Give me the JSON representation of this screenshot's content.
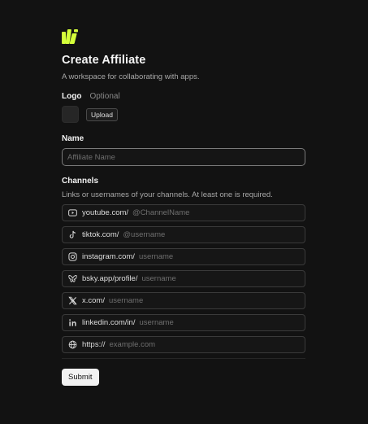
{
  "brand": {
    "accent": "#d4ff3a"
  },
  "header": {
    "title": "Create Affiliate",
    "subtitle": "A workspace for collaborating with apps."
  },
  "logo_field": {
    "label": "Logo",
    "optional": "Optional",
    "upload_label": "Upload"
  },
  "name_field": {
    "label": "Name",
    "placeholder": "Affiliate Name",
    "value": ""
  },
  "channels": {
    "label": "Channels",
    "description": "Links or usernames of your channels. At least one is required.",
    "items": [
      {
        "icon": "youtube-icon",
        "prefix": "youtube.com/",
        "placeholder": "@ChannelName",
        "value": ""
      },
      {
        "icon": "tiktok-icon",
        "prefix": "tiktok.com/",
        "placeholder": "@username",
        "value": ""
      },
      {
        "icon": "instagram-icon",
        "prefix": "instagram.com/",
        "placeholder": "username",
        "value": ""
      },
      {
        "icon": "bluesky-icon",
        "prefix": "bsky.app/profile/",
        "placeholder": "username",
        "value": ""
      },
      {
        "icon": "x-icon",
        "prefix": "x.com/",
        "placeholder": "username",
        "value": ""
      },
      {
        "icon": "linkedin-icon",
        "prefix": "linkedin.com/in/",
        "placeholder": "username",
        "value": ""
      },
      {
        "icon": "globe-icon",
        "prefix": "https://",
        "placeholder": "example.com",
        "value": ""
      }
    ]
  },
  "form": {
    "submit_label": "Submit"
  }
}
